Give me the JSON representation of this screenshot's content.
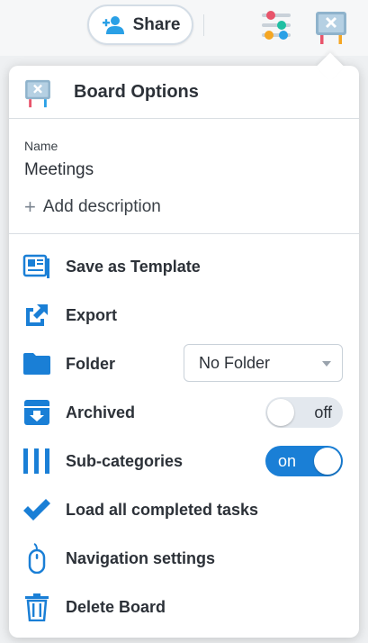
{
  "toolbar": {
    "share_label": "Share"
  },
  "popover": {
    "title": "Board Options",
    "name_label": "Name",
    "name_value": "Meetings",
    "add_description_label": "Add description",
    "items": [
      {
        "label": "Save as Template",
        "icon": "template-icon"
      },
      {
        "label": "Export",
        "icon": "export-icon"
      },
      {
        "label": "Folder",
        "icon": "folder-icon"
      },
      {
        "label": "Archived",
        "icon": "archive-icon"
      },
      {
        "label": "Sub-categories",
        "icon": "columns-icon"
      },
      {
        "label": "Load all completed tasks",
        "icon": "checkmark-icon"
      },
      {
        "label": "Navigation settings",
        "icon": "mouse-icon"
      },
      {
        "label": "Delete Board",
        "icon": "trash-icon"
      }
    ],
    "folder_select_value": "No Folder",
    "archived_toggle": "off",
    "subcategories_toggle": "on"
  },
  "colors": {
    "accent": "#1a7fd6",
    "text": "#2c3138"
  }
}
